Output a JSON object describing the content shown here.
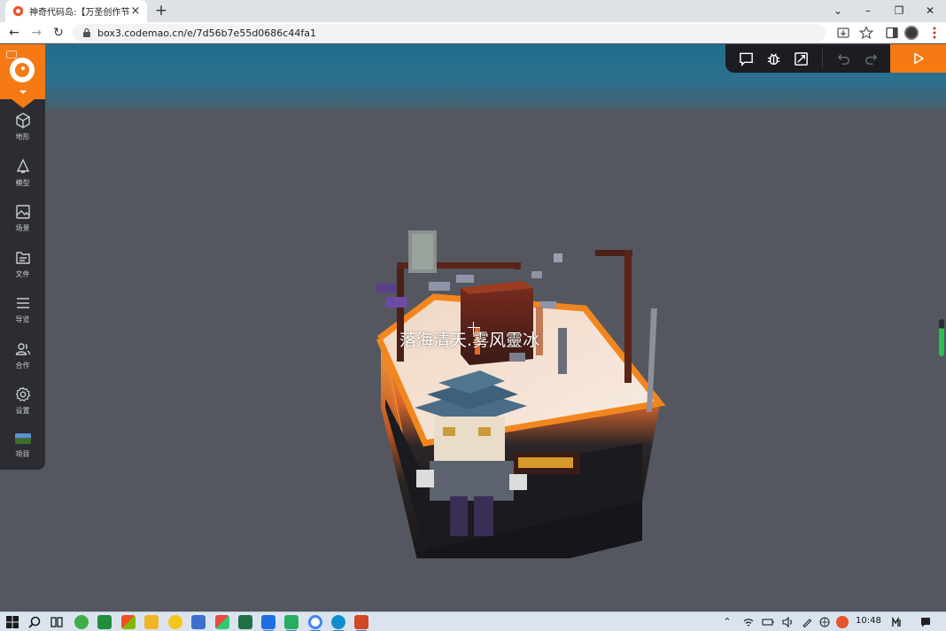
{
  "browser": {
    "tab": {
      "title": "神奇代码岛:【万圣创作节】",
      "close_icon": "×",
      "favicon_color": "#e8552d"
    },
    "new_tab_icon": "+",
    "window_controls": {
      "chevron": "⌄",
      "minimize": "–",
      "restore": "❐",
      "close": "✕"
    },
    "nav": {
      "back": "←",
      "forward": "→",
      "reload": "↻"
    },
    "url": "box3.codemao.cn/e/7d56b7e55d0686c44fa1"
  },
  "sidebar": {
    "items": [
      {
        "id": "terrain",
        "label": "地形",
        "icon": "cube-icon"
      },
      {
        "id": "model",
        "label": "模型",
        "icon": "bell-icon"
      },
      {
        "id": "scene",
        "label": "场景",
        "icon": "picture-icon"
      },
      {
        "id": "file",
        "label": "文件",
        "icon": "folder-icon"
      },
      {
        "id": "navigation",
        "label": "导览",
        "icon": "list-icon"
      },
      {
        "id": "cooperate",
        "label": "合作",
        "icon": "users-icon"
      },
      {
        "id": "settings",
        "label": "设置",
        "icon": "gear-icon"
      },
      {
        "id": "project",
        "label": "项目",
        "icon": "project-thumbnail"
      }
    ]
  },
  "toolbar": {
    "buttons": [
      "chat-icon",
      "debug-bug-icon",
      "fullscreen-icon",
      "undo-icon",
      "redo-icon"
    ],
    "run_icon": "play-icon",
    "accent_color": "#f57a14"
  },
  "scene": {
    "player_name": "落海清天.雾风靈冰"
  },
  "taskbar": {
    "clock": "10:48"
  }
}
